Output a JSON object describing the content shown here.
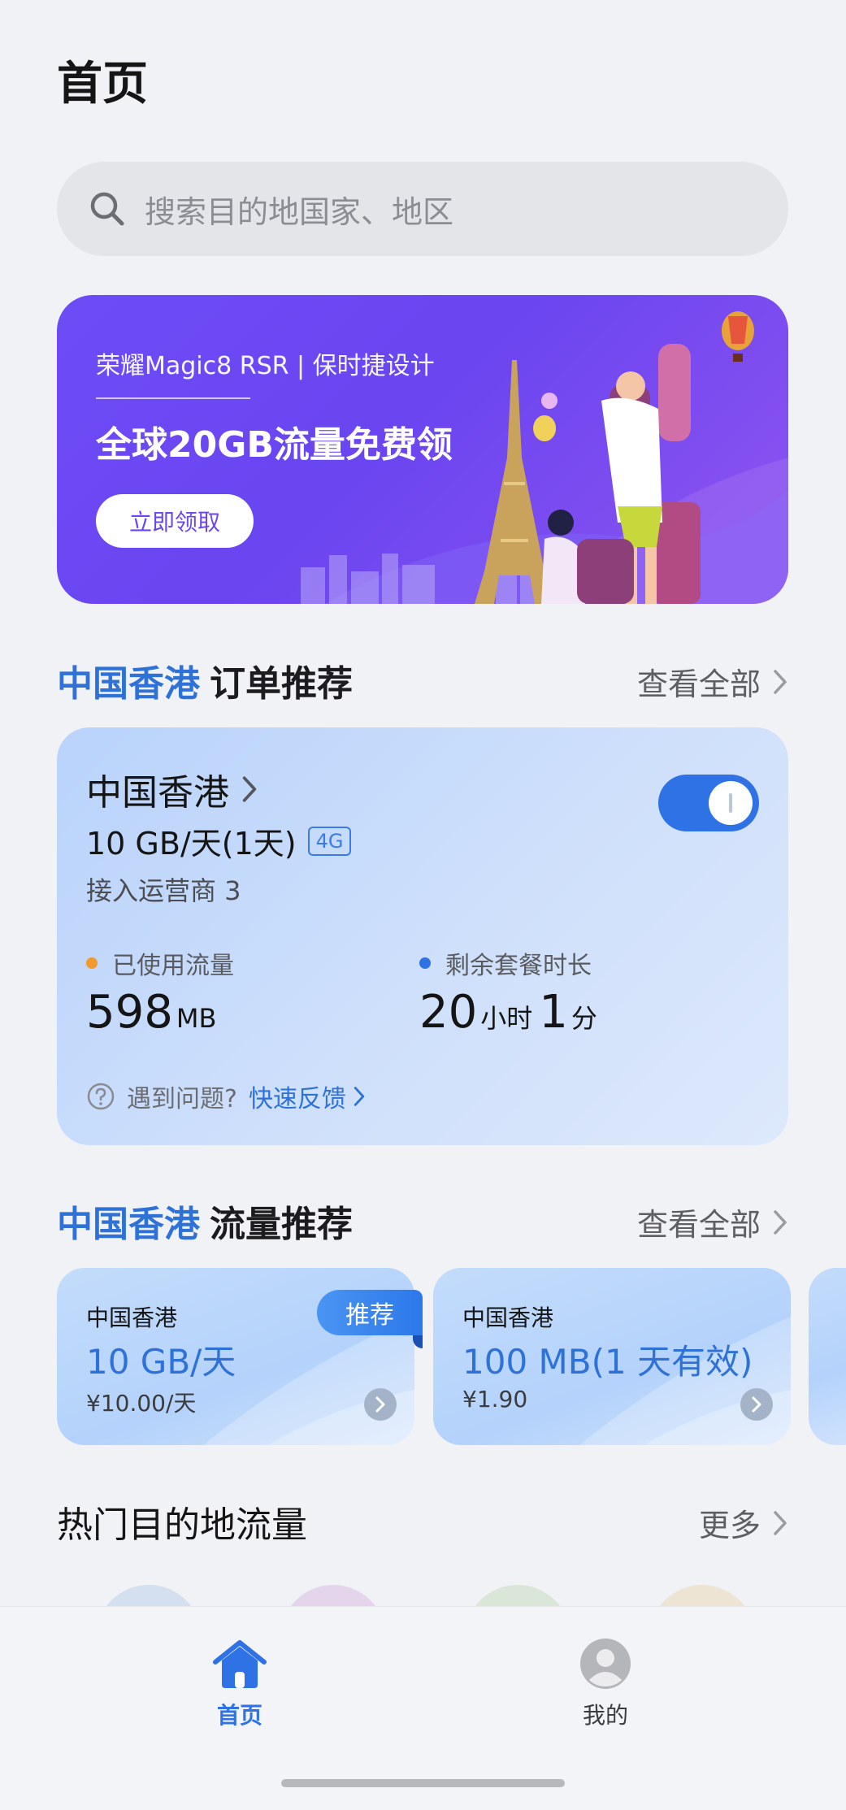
{
  "page": {
    "title": "首页"
  },
  "search": {
    "placeholder": "搜索目的地国家、地区"
  },
  "banner": {
    "subtitle": "荣耀Magic8 RSR | 保时捷设计",
    "title": "全球20GB流量免费领",
    "button": "立即领取"
  },
  "order_section": {
    "region": "中国香港",
    "title": "订单推荐",
    "view_all": "查看全部"
  },
  "order_card": {
    "region": "中国香港",
    "plan": "10 GB/天(1天)",
    "network_badge": "4G",
    "carrier": "接入运营商 3",
    "toggle_on": true,
    "used_label": "已使用流量",
    "used_value": "598",
    "used_unit": "MB",
    "remaining_label": "剩余套餐时长",
    "remaining_hours": "20",
    "hours_unit": "小时",
    "remaining_minutes": "1",
    "minutes_unit": "分",
    "help_text": "遇到问题?",
    "feedback_link": "快速反馈",
    "colors": {
      "used_dot": "#f29a2e",
      "remaining_dot": "#2e72e6"
    }
  },
  "traffic_section": {
    "region": "中国香港",
    "title": "流量推荐",
    "view_all": "查看全部"
  },
  "packages": [
    {
      "region": "中国香港",
      "amount": "10 GB/天",
      "price": "¥10.00/天",
      "tag": "推荐"
    },
    {
      "region": "中国香港",
      "amount": "100 MB(1 天有效)",
      "price": "¥1.90"
    }
  ],
  "hot_section": {
    "title": "热门目的地流量",
    "more": "更多"
  },
  "tabbar": {
    "items": [
      {
        "label": "首页",
        "icon": "home-icon",
        "active": true
      },
      {
        "label": "我的",
        "icon": "avatar-icon",
        "active": false
      }
    ],
    "active_color": "#2e72e6"
  }
}
